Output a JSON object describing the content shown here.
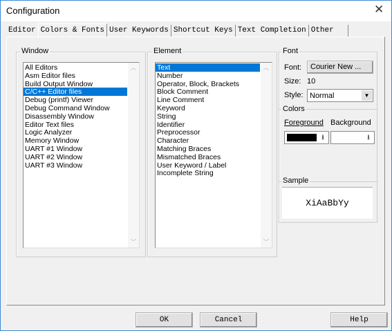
{
  "window": {
    "title": "Configuration",
    "close_icon": "close-icon"
  },
  "tabs": [
    {
      "label": "Editor"
    },
    {
      "label": "Colors & Fonts",
      "active": true
    },
    {
      "label": "User Keywords"
    },
    {
      "label": "Shortcut Keys"
    },
    {
      "label": "Text Completion"
    },
    {
      "label": "Other"
    }
  ],
  "window_group": {
    "label": "Window",
    "items": [
      "All Editors",
      "Asm Editor files",
      "Build Output Window",
      "C/C++ Editor files",
      "Debug (printf) Viewer",
      "Debug Command Window",
      "Disassembly Window",
      "Editor Text files",
      "Logic Analyzer",
      "Memory Window",
      "UART #1 Window",
      "UART #2 Window",
      "UART #3 Window"
    ],
    "selected": "C/C++ Editor files"
  },
  "element_group": {
    "label": "Element",
    "items": [
      "Text",
      "Number",
      "Operator, Block, Brackets",
      "Block Comment",
      "Line Comment",
      "Keyword",
      "String",
      "Identifier",
      "Preprocessor",
      "Character",
      "Matching Braces",
      "Mismatched Braces",
      "User Keyword / Label",
      "Incomplete String"
    ],
    "selected": "Text"
  },
  "font_group": {
    "label": "Font",
    "font_label": "Font:",
    "font_button": "Courier New ...",
    "size_label": "Size:",
    "size_value": "10",
    "style_label": "Style:",
    "style_value": "Normal"
  },
  "colors_group": {
    "label": "Colors",
    "foreground_label": "Foreground",
    "background_label": "Background",
    "foreground_color": "#000000",
    "background_color": "#ffffff"
  },
  "sample_group": {
    "label": "Sample",
    "text": "XiAaBbYy"
  },
  "buttons": {
    "ok": "OK",
    "cancel": "Cancel",
    "help": "Help"
  },
  "colors": {
    "selection": "#0078d7"
  }
}
